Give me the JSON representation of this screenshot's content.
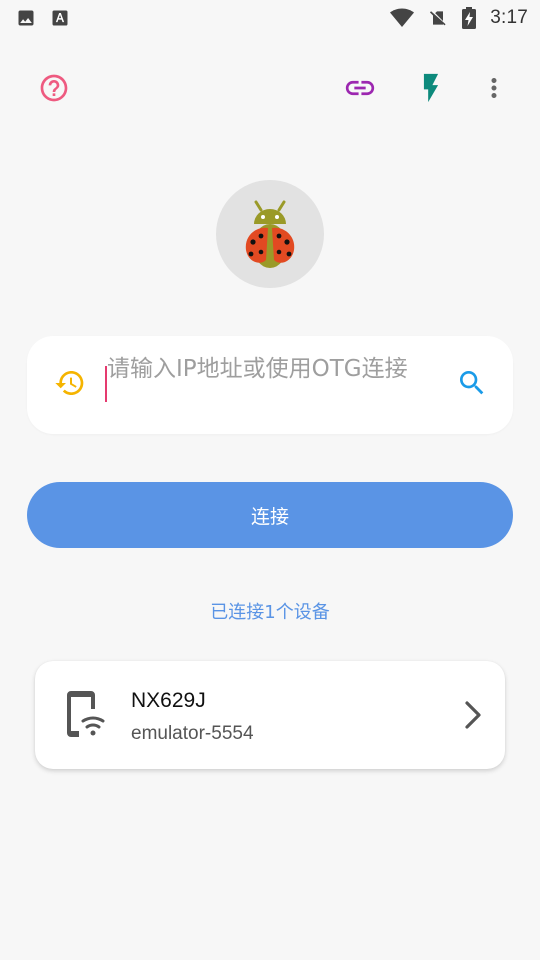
{
  "status_bar": {
    "time": "3:17",
    "left_icons": [
      "image-icon",
      "text-a-icon"
    ],
    "right_icons": [
      "wifi-icon",
      "no-sim-icon",
      "battery-charging-icon"
    ]
  },
  "toolbar": {
    "help_icon": "help-circle-icon",
    "link_icon": "link-icon",
    "flash_icon": "flash-icon",
    "menu_icon": "more-vert-icon",
    "colors": {
      "help": "#ee5a80",
      "link": "#9c27b0",
      "flash": "#0d8a7c",
      "menu": "#666666"
    }
  },
  "logo": {
    "icon": "ladybug-android-icon"
  },
  "address": {
    "placeholder": "请输入IP地址或使用OTG连接",
    "value": "",
    "history_icon": "history-icon",
    "search_icon": "search-icon",
    "history_color": "#f5b400",
    "search_color": "#1a9be8"
  },
  "connect_button": {
    "label": "连接",
    "color": "#5a94e5"
  },
  "connected_status": "已连接1个设备",
  "devices": [
    {
      "name": "NX629J",
      "serial": "emulator-5554",
      "icon": "phone-wifi-icon"
    }
  ]
}
